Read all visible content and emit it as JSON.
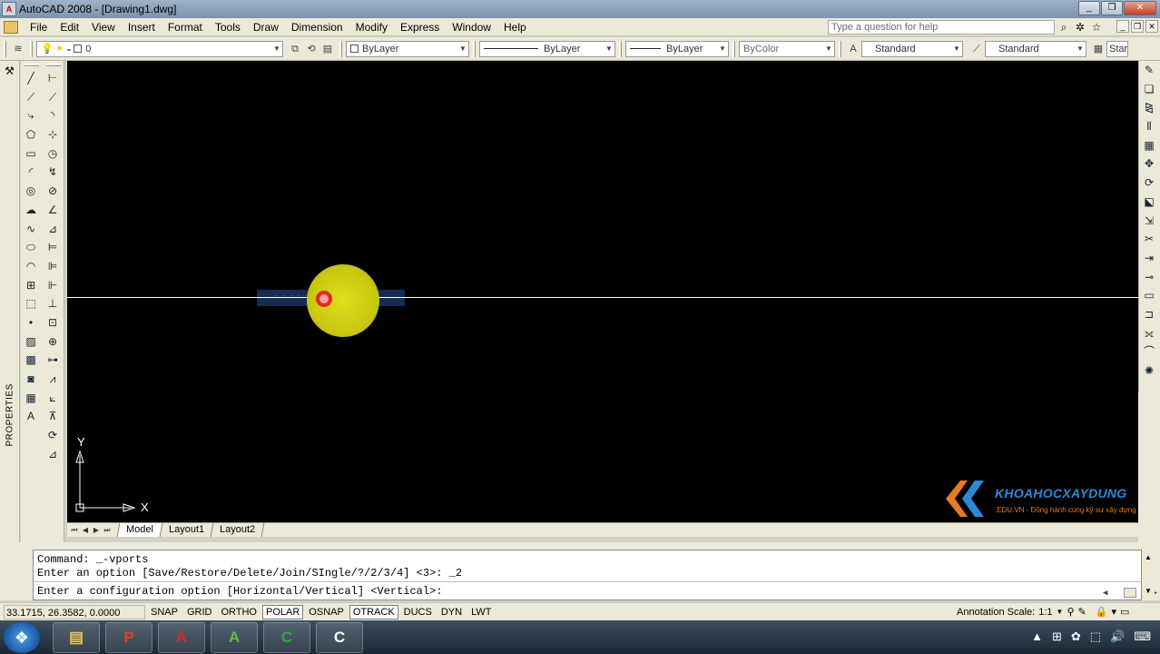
{
  "window": {
    "title": "AutoCAD 2008 - [Drawing1.dwg]",
    "app_icon_label": "A",
    "controls": [
      "_",
      "❐",
      "✕"
    ]
  },
  "menu": {
    "items": [
      "File",
      "Edit",
      "View",
      "Insert",
      "Format",
      "Tools",
      "Draw",
      "Dimension",
      "Modify",
      "Express",
      "Window",
      "Help"
    ],
    "help_placeholder": "Type a question for help",
    "doc_controls": [
      "_",
      "❐",
      "✕"
    ]
  },
  "properties_toolbar": {
    "layer_value": "0",
    "color_value": "ByLayer",
    "linetype_value": "ByLayer",
    "lineweight_value": "ByLayer",
    "plotstyle_value": "ByColor",
    "text_style": "Standard",
    "dim_style": "Standard",
    "table_style_partial": "Star"
  },
  "left_palette": {
    "label": "PROPERTIES"
  },
  "draw_tools": [
    {
      "name": "line-tool-icon",
      "glyph": "╱"
    },
    {
      "name": "construction-line-icon",
      "glyph": "⟋"
    },
    {
      "name": "polyline-icon",
      "glyph": "⤷"
    },
    {
      "name": "polygon-icon",
      "glyph": "⬠"
    },
    {
      "name": "rectangle-icon",
      "glyph": "▭"
    },
    {
      "name": "arc-icon",
      "glyph": "◜"
    },
    {
      "name": "circle-icon",
      "glyph": "◎"
    },
    {
      "name": "revision-cloud-icon",
      "glyph": "☁"
    },
    {
      "name": "spline-icon",
      "glyph": "∿"
    },
    {
      "name": "ellipse-icon",
      "glyph": "⬭"
    },
    {
      "name": "ellipse-arc-icon",
      "glyph": "◠"
    },
    {
      "name": "insert-block-icon",
      "glyph": "⊞"
    },
    {
      "name": "make-block-icon",
      "glyph": "⬚"
    },
    {
      "name": "point-icon",
      "glyph": "•"
    },
    {
      "name": "hatch-icon",
      "glyph": "▨"
    },
    {
      "name": "gradient-icon",
      "glyph": "▩"
    },
    {
      "name": "region-icon",
      "glyph": "◙"
    },
    {
      "name": "table-icon",
      "glyph": "▦"
    },
    {
      "name": "multiline-text-icon",
      "glyph": "A"
    }
  ],
  "dim_tools": [
    {
      "name": "linear-dimension-icon",
      "glyph": "⊢"
    },
    {
      "name": "aligned-dimension-icon",
      "glyph": "⟋"
    },
    {
      "name": "arc-length-icon",
      "glyph": "◝"
    },
    {
      "name": "ordinate-dimension-icon",
      "glyph": "⊹"
    },
    {
      "name": "radius-dimension-icon",
      "glyph": "◷"
    },
    {
      "name": "jogged-dimension-icon",
      "glyph": "↯"
    },
    {
      "name": "diameter-dimension-icon",
      "glyph": "⊘"
    },
    {
      "name": "angular-dimension-icon",
      "glyph": "∠"
    },
    {
      "name": "quick-dimension-icon",
      "glyph": "⊿"
    },
    {
      "name": "baseline-dimension-icon",
      "glyph": "⊨"
    },
    {
      "name": "continue-dimension-icon",
      "glyph": "⊫"
    },
    {
      "name": "dimension-space-icon",
      "glyph": "⊩"
    },
    {
      "name": "dimension-break-icon",
      "glyph": "⊥"
    },
    {
      "name": "tolerance-icon",
      "glyph": "⊡"
    },
    {
      "name": "center-mark-icon",
      "glyph": "⊕"
    },
    {
      "name": "inspection-icon",
      "glyph": "⊶"
    },
    {
      "name": "jogged-linear-icon",
      "glyph": "⩘"
    },
    {
      "name": "dimension-edit-icon",
      "glyph": "⟀"
    },
    {
      "name": "dimension-text-edit-icon",
      "glyph": "⊼"
    },
    {
      "name": "dimension-update-icon",
      "glyph": "⟳"
    },
    {
      "name": "dimension-style-icon",
      "glyph": "⊿"
    }
  ],
  "modify_tools": [
    {
      "name": "erase-icon",
      "glyph": "✎"
    },
    {
      "name": "copy-icon",
      "glyph": "❏"
    },
    {
      "name": "mirror-icon",
      "glyph": "⧎"
    },
    {
      "name": "offset-icon",
      "glyph": "⫴"
    },
    {
      "name": "array-icon",
      "glyph": "▦"
    },
    {
      "name": "move-icon",
      "glyph": "✥"
    },
    {
      "name": "rotate-icon",
      "glyph": "⟳"
    },
    {
      "name": "scale-icon",
      "glyph": "⬕"
    },
    {
      "name": "stretch-icon",
      "glyph": "⇲"
    },
    {
      "name": "trim-icon",
      "glyph": "✂"
    },
    {
      "name": "extend-icon",
      "glyph": "⇥"
    },
    {
      "name": "break-at-point-icon",
      "glyph": "⊸"
    },
    {
      "name": "break-icon",
      "glyph": "▭"
    },
    {
      "name": "join-icon",
      "glyph": "⊐"
    },
    {
      "name": "chamfer-icon",
      "glyph": "⟗"
    },
    {
      "name": "fillet-icon",
      "glyph": "⌒"
    },
    {
      "name": "explode-icon",
      "glyph": "✺"
    }
  ],
  "canvas": {
    "ucs_x": "X",
    "ucs_y": "Y",
    "watermark_name": "KHOAHOCXAYDUNG",
    "watermark_sub": ".EDU.VN - Đồng hành cùng kỹ sư xây dựng",
    "background": "#000000",
    "line_color": "#ffffff",
    "selection_color": "#2a4f8f"
  },
  "layout_tabs": {
    "nav": [
      "⏮",
      "◀",
      "▶",
      "⏭"
    ],
    "tabs": [
      "Model",
      "Layout1",
      "Layout2"
    ],
    "active": "Model"
  },
  "command": {
    "history": [
      "Command: _-vports",
      "Enter an option [Save/Restore/Delete/Join/SIngle/?/2/3/4] <3>: _2"
    ],
    "prompt": "Enter a configuration option [Horizontal/Vertical] <Vertical>:"
  },
  "status": {
    "coords": "33.1715, 26.3582, 0.0000",
    "toggles": [
      {
        "label": "SNAP",
        "on": false
      },
      {
        "label": "GRID",
        "on": false
      },
      {
        "label": "ORTHO",
        "on": false
      },
      {
        "label": "POLAR",
        "on": true
      },
      {
        "label": "OSNAP",
        "on": false
      },
      {
        "label": "OTRACK",
        "on": true
      },
      {
        "label": "DUCS",
        "on": false
      },
      {
        "label": "DYN",
        "on": false
      },
      {
        "label": "LWT",
        "on": false
      }
    ],
    "annotation_label": "Annotation Scale:",
    "annotation_value": "1:1"
  },
  "taskbar": {
    "start_glyph": "❖",
    "apps": [
      {
        "name": "file-explorer-icon",
        "glyph": "▤",
        "color": "#e8c25a"
      },
      {
        "name": "powerpoint-icon",
        "glyph": "P",
        "color": "#d24726"
      },
      {
        "name": "autocad-icon",
        "glyph": "A",
        "color": "#d12a2a"
      },
      {
        "name": "autocad-2008-icon",
        "glyph": "A",
        "color": "#5fbf3f"
      },
      {
        "name": "camtasia-icon",
        "glyph": "C",
        "color": "#3aa535"
      },
      {
        "name": "camtasia-recorder-icon",
        "glyph": "C",
        "color": "#ffffff"
      }
    ],
    "tray": [
      "▲",
      "⊞",
      "✿",
      "⬚",
      "🔊",
      "⌨"
    ]
  }
}
